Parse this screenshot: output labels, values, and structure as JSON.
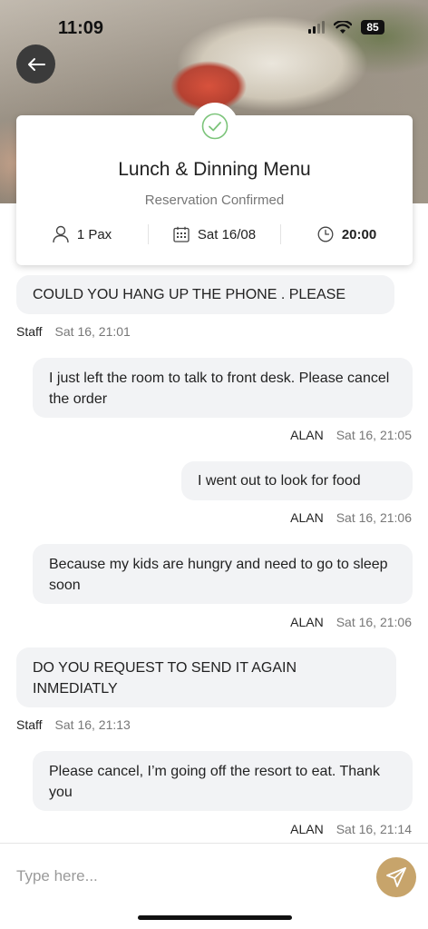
{
  "status_bar": {
    "time": "11:09",
    "battery": "85"
  },
  "header": {
    "back_icon": "arrow-left-icon"
  },
  "reservation_card": {
    "status_icon": "check-circle-icon",
    "title": "Lunch & Dinning Menu",
    "subtitle": "Reservation Confirmed",
    "guests": {
      "icon": "person-icon",
      "value": "1 Pax"
    },
    "date": {
      "icon": "calendar-icon",
      "value": "Sat 16/08"
    },
    "time": {
      "icon": "clock-icon",
      "value": "20:00"
    }
  },
  "messages": [
    {
      "text": "COULD YOU HANG UP THE PHONE . PLEASE",
      "sender": "Staff",
      "timestamp": "Sat 16, 21:01",
      "side": "left"
    },
    {
      "text": "I just left the room to talk to front desk. Please cancel the order",
      "sender": "ALAN",
      "timestamp": "Sat 16, 21:05",
      "side": "right"
    },
    {
      "text": "I went out to look for food",
      "sender": "ALAN",
      "timestamp": "Sat 16, 21:06",
      "side": "right"
    },
    {
      "text": "Because my kids are hungry and need to go to sleep soon",
      "sender": "ALAN",
      "timestamp": "Sat 16, 21:06",
      "side": "right"
    },
    {
      "text": "DO YOU REQUEST TO SEND IT AGAIN INMEDIATLY",
      "sender": "Staff",
      "timestamp": "Sat 16, 21:13",
      "side": "left"
    },
    {
      "text": "Please cancel, I’m going off the resort to eat. Thank you",
      "sender": "ALAN",
      "timestamp": "Sat 16, 21:14",
      "side": "right"
    }
  ],
  "composer": {
    "placeholder": "Type here...",
    "send_icon": "send-icon"
  },
  "colors": {
    "accent": "#c7a46b",
    "check": "#7cc47a",
    "bubble": "#f2f3f5"
  }
}
